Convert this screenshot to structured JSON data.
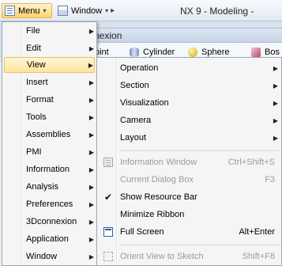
{
  "toolbar": {
    "menu_label": "Menu",
    "menu_caret": "▾",
    "window_label": "Window",
    "window_caret": "▾",
    "separator": "▸",
    "app_title": "NX 9 - Modeling -"
  },
  "ribbon": {
    "tab_partial": "nexion",
    "items": [
      {
        "label": "Point",
        "visible_text": "oint",
        "icon": "point-icon"
      },
      {
        "label": "Cylinder",
        "icon": "cylinder-icon"
      },
      {
        "label": "Sphere",
        "icon": "sphere-icon"
      },
      {
        "label": "Box",
        "visible_text": "Bos",
        "icon": "box-icon"
      }
    ]
  },
  "main_menu": {
    "active_item": "View",
    "items": [
      {
        "label": "File",
        "has_submenu": true
      },
      {
        "label": "Edit",
        "has_submenu": true
      },
      {
        "label": "View",
        "has_submenu": true
      },
      {
        "label": "Insert",
        "has_submenu": true
      },
      {
        "label": "Format",
        "has_submenu": true
      },
      {
        "label": "Tools",
        "has_submenu": true
      },
      {
        "label": "Assemblies",
        "has_submenu": true
      },
      {
        "label": "PMI",
        "has_submenu": true
      },
      {
        "label": "Information",
        "has_submenu": true
      },
      {
        "label": "Analysis",
        "has_submenu": true
      },
      {
        "label": "Preferences",
        "has_submenu": true
      },
      {
        "label": "3Dconnexion",
        "has_submenu": true
      },
      {
        "label": "Application",
        "has_submenu": true
      },
      {
        "label": "Window",
        "has_submenu": true
      }
    ]
  },
  "view_submenu": {
    "items": [
      {
        "label": "Operation",
        "has_submenu": true
      },
      {
        "label": "Section",
        "has_submenu": true
      },
      {
        "label": "Visualization",
        "has_submenu": true
      },
      {
        "label": "Camera",
        "has_submenu": true
      },
      {
        "label": "Layout",
        "has_submenu": true
      },
      {
        "label": "Information Window",
        "shortcut": "Ctrl+Shift+S",
        "disabled": true,
        "icon": "information-window-icon"
      },
      {
        "label": "Current Dialog Box",
        "shortcut": "F3",
        "disabled": true
      },
      {
        "label": "Show Resource Bar",
        "checked": true,
        "icon": "checkmark-icon"
      },
      {
        "label": "Minimize Ribbon"
      },
      {
        "label": "Full Screen",
        "shortcut": "Alt+Enter",
        "icon": "full-screen-icon"
      },
      {
        "label": "Orient View to Sketch",
        "shortcut": "Shift+F8",
        "disabled": true,
        "icon": "orient-view-icon"
      }
    ]
  },
  "arrow_glyph": "▶",
  "check_glyph": "✔"
}
